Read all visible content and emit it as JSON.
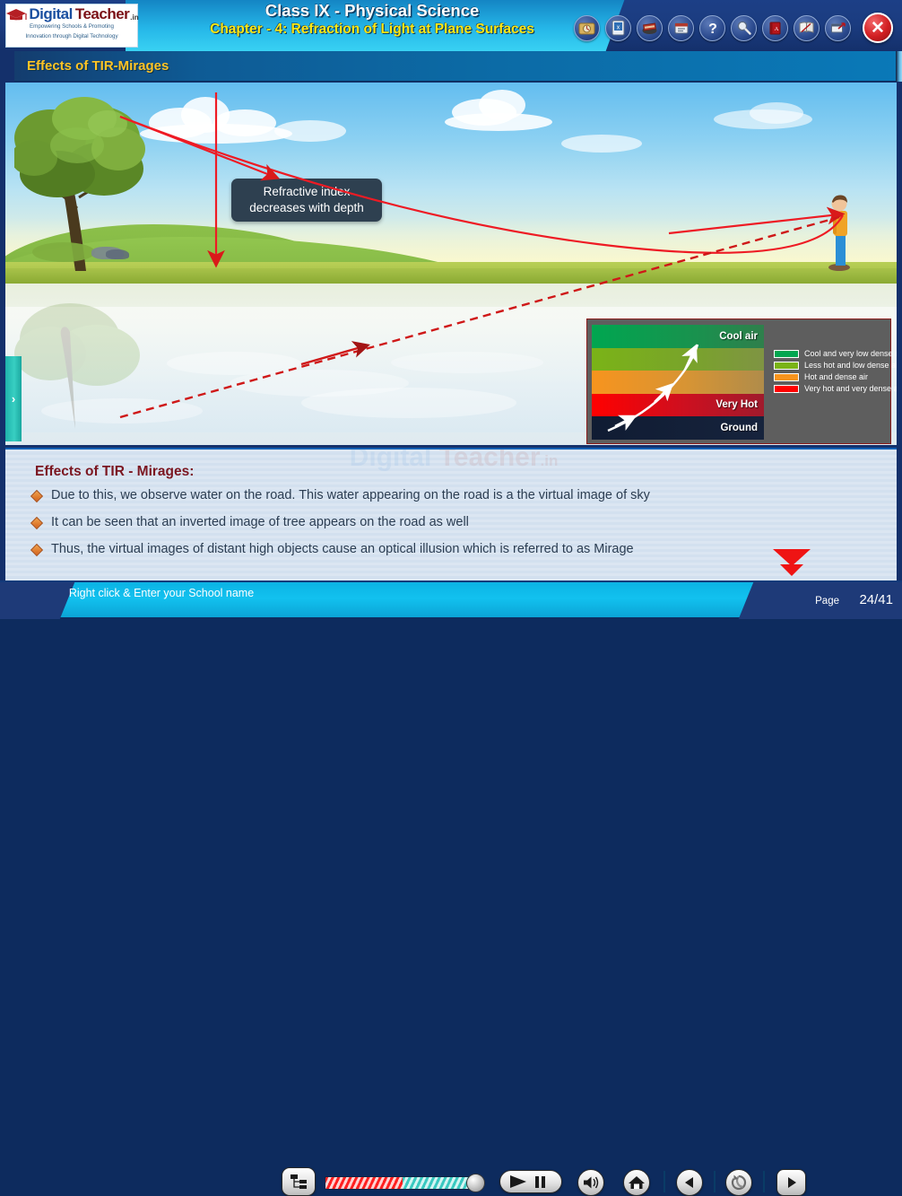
{
  "header": {
    "logo": {
      "brand_primary": "Digital",
      "brand_secondary": "Teacher",
      "brand_tld": ".in",
      "tagline_line1": "Empowering Schools & Promoting",
      "tagline_line2": "Innovation through Digital Technology"
    },
    "title_main": "Class IX - Physical Science",
    "title_sub": "Chapter - 4: Refraction of Light at Plane Surfaces",
    "toolbar_icons": [
      "gallery-icon",
      "presentation-icon",
      "chalkboard-icon",
      "notes-icon",
      "help-icon",
      "search-icon",
      "dictionary-icon",
      "bookmark-icon",
      "external-window-icon"
    ],
    "close_label": "✕"
  },
  "section": {
    "title": "Effects of TIR-Mirages"
  },
  "scene": {
    "callout_text": "Refractive index decreases with depth",
    "side_tab_label": "›",
    "legend": {
      "bands": [
        {
          "label": "Cool air",
          "color": "#00a650"
        },
        {
          "label": "",
          "color": "#7ab317"
        },
        {
          "label": "",
          "color": "#f7941e"
        },
        {
          "label": "Very Hot",
          "color": "#ff0000"
        },
        {
          "label": "Ground",
          "color": "#101c33"
        }
      ],
      "keys": [
        {
          "swatch": "#00a650",
          "text": "Cool and very low dense air"
        },
        {
          "swatch": "#7ab317",
          "text": "Less hot and low dense air"
        },
        {
          "swatch": "#f7941e",
          "text": "Hot and dense air"
        },
        {
          "swatch": "#ff0000",
          "text": "Very hot and very dense air"
        }
      ]
    }
  },
  "content": {
    "watermark_a": "Digital",
    "watermark_b": " Teacher",
    "watermark_c": ".in",
    "title": "Effects of TIR - Mirages:",
    "bullets": [
      "Due to this, we observe water on the road. This water appearing on the road is a the virtual image of sky",
      "It can be seen that an inverted image of tree appears on the road as well",
      "Thus, the virtual images of distant high objects cause an optical illusion which is referred to as Mirage"
    ]
  },
  "footer": {
    "school_note": "Right click & Enter your School name",
    "buttons": [
      "outline-button",
      "play-button",
      "pause-button",
      "volume-button",
      "home-button",
      "previous-button",
      "refresh-button",
      "next-button"
    ],
    "page_label": "Page",
    "page_number": "24/41"
  },
  "colors": {
    "accent_yellow": "#ffc425",
    "header_blue": "#1b3c80",
    "footer_cyan": "#0bb3e4",
    "ray_red": "#ee1b24",
    "title_maroon": "#7b1620"
  }
}
